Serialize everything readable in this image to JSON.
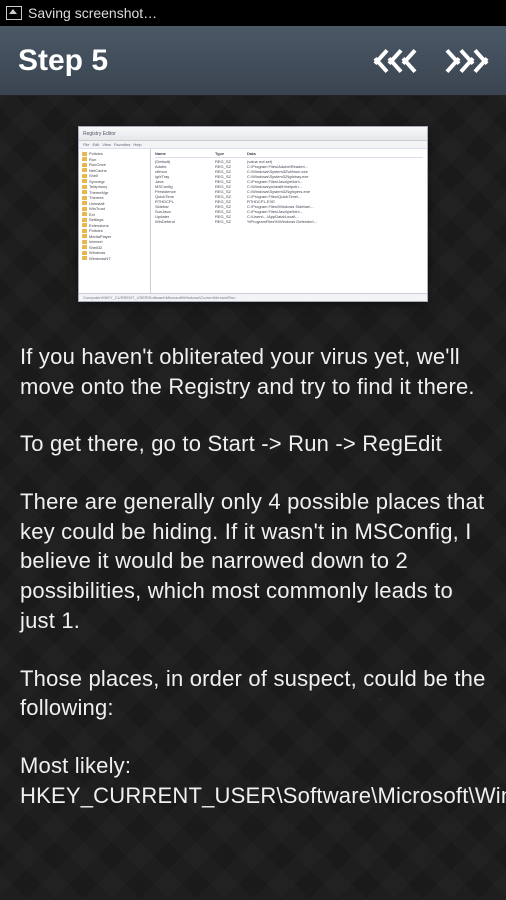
{
  "status": {
    "text": "Saving screenshot…"
  },
  "header": {
    "title": "Step 5"
  },
  "thumbnail": {
    "window_title": "Registry Editor",
    "menu": [
      "File",
      "Edit",
      "View",
      "Favorites",
      "Help"
    ],
    "list_cols": [
      "Name",
      "Type",
      "Data"
    ],
    "status_path": "Computer\\HKEY_CURRENT_USER\\Software\\Microsoft\\Windows\\CurrentVersion\\Run",
    "tree_items": [
      "Policies",
      "Run",
      "RunOnce",
      "NetCache",
      "Shell",
      "Syncmgr",
      "Telephony",
      "ThemeMgr",
      "Themes",
      "Uninstall",
      "WinTrust",
      "Ext",
      "Settings",
      "Extensions",
      "Policies",
      "MediaPlayer",
      "Internet",
      "Shell32",
      "Windows",
      "WindowsNT"
    ],
    "rows": [
      {
        "n": "(Default)",
        "t": "REG_SZ",
        "d": "(value not set)"
      },
      {
        "n": "Adobe",
        "t": "REG_SZ",
        "d": "C:\\Program Files\\Adobe\\Reader\\..."
      },
      {
        "n": "ctfmon",
        "t": "REG_SZ",
        "d": "C:\\Windows\\System32\\ctfmon.exe"
      },
      {
        "n": "IgfxTray",
        "t": "REG_SZ",
        "d": "C:\\Windows\\System32\\igfxtray.exe"
      },
      {
        "n": "Java",
        "t": "REG_SZ",
        "d": "C:\\Program Files\\Java\\jre\\bin\\..."
      },
      {
        "n": "MSConfig",
        "t": "REG_SZ",
        "d": "C:\\Windows\\pchealth\\helpctr\\..."
      },
      {
        "n": "Persistence",
        "t": "REG_SZ",
        "d": "C:\\Windows\\System32\\igfxpers.exe"
      },
      {
        "n": "QuickTime",
        "t": "REG_SZ",
        "d": "C:\\Program Files\\QuickTime\\..."
      },
      {
        "n": "RTHDCPL",
        "t": "REG_SZ",
        "d": "RTHDCPL.EXE"
      },
      {
        "n": "Sidebar",
        "t": "REG_SZ",
        "d": "C:\\Program Files\\Windows Sidebar\\..."
      },
      {
        "n": "SunJava",
        "t": "REG_SZ",
        "d": "C:\\Program Files\\Java\\jre\\bin\\..."
      },
      {
        "n": "Updater",
        "t": "REG_SZ",
        "d": "C:\\Users\\...\\AppData\\Local\\..."
      },
      {
        "n": "WinDefend",
        "t": "REG_SZ",
        "d": "%ProgramFiles%\\Windows Defender\\..."
      }
    ]
  },
  "body": {
    "p1": "If you haven't obliterated your virus yet, we'll move onto the Registry and try to find it there.",
    "p2": "To get there, go to Start -> Run -> RegEdit",
    "p3": "There are generally only 4 possible places that key could be hiding. If it wasn't in MSConfig, I believe it would be narrowed down to 2 possibilities, which most commonly leads to just 1.",
    "p4": "Those places, in order of suspect, could be the following:",
    "p5": "Most likely:\nHKEY_CURRENT_USER\\Software\\Microsoft\\Windows\\CurrentVersion\\RunOnce"
  }
}
